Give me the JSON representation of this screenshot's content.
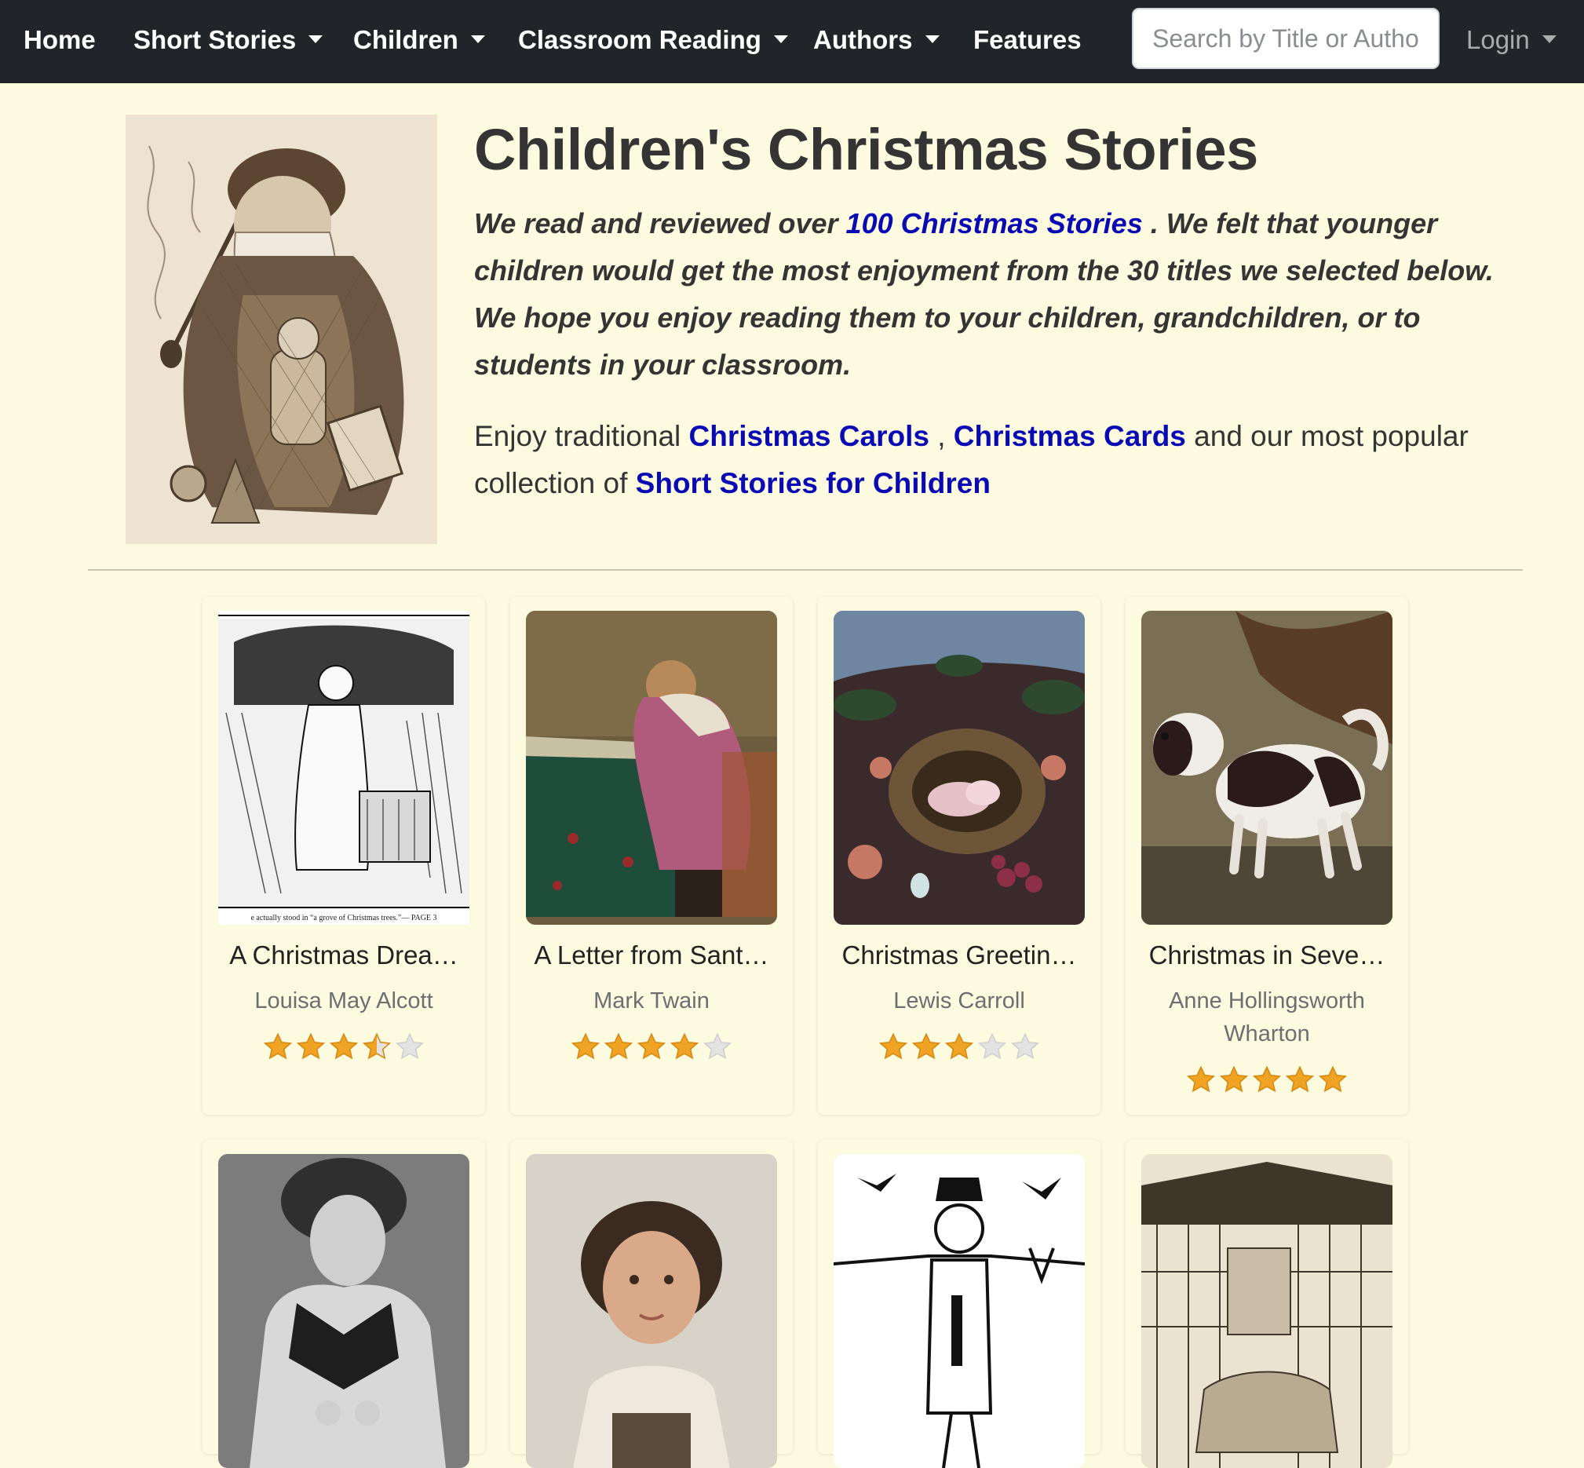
{
  "nav": {
    "home": "Home",
    "short_stories": "Short Stories",
    "children": "Children",
    "classroom_reading": "Classroom Reading",
    "authors": "Authors",
    "features": "Features",
    "search_placeholder": "Search by Title or Author",
    "login": "Login"
  },
  "hero": {
    "title": "Children's Christmas Stories",
    "intro_before": "We read and reviewed over ",
    "intro_link": "100 Christmas Stories",
    "intro_after": " . We felt that younger children would get the most enjoyment from the 30 titles we selected below. We hope you enjoy reading them to your children, grandchildren, or to students in your classroom.",
    "enjoy_before": "Enjoy traditional ",
    "carols_link": "Christmas Carols",
    "comma": " , ",
    "cards_link": "Christmas Cards",
    "enjoy_middle": " and our most popular collection of ",
    "children_link": "Short Stories for Children",
    "image_caption": "e actually stood in “a grove of Christmas trees.”— PAGE 3"
  },
  "cards": [
    {
      "title": "A Christmas Drea…",
      "author": "Louisa May Alcott",
      "rating": 3.5
    },
    {
      "title": "A Letter from Sant…",
      "author": "Mark Twain",
      "rating": 4
    },
    {
      "title": "Christmas Greetin…",
      "author": "Lewis Carroll",
      "rating": 3
    },
    {
      "title": "Christmas in Seve…",
      "author": "Anne Hollingsworth Wharton",
      "rating": 5
    }
  ],
  "colors": {
    "navbar": "#212529",
    "background": "#fdfbdf",
    "link": "#0a0ab4",
    "star_filled": "#f0a323",
    "star_empty": "#e3e3e3"
  },
  "icons": {
    "dropdown": "caret-down-icon",
    "rating": "star-icon"
  }
}
